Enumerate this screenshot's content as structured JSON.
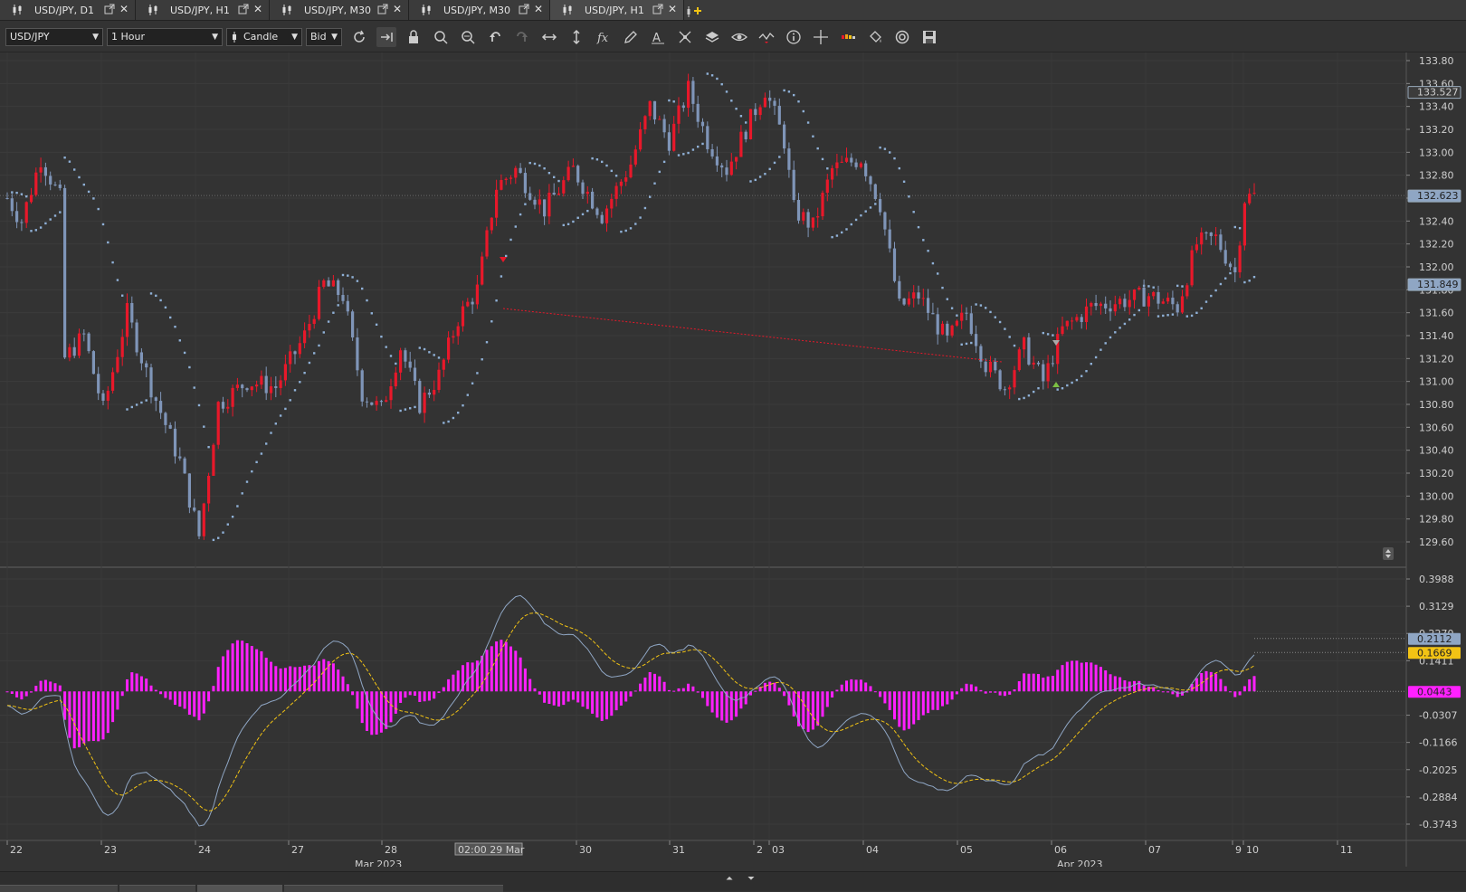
{
  "tabs": [
    {
      "label": "USD/JPY, D1",
      "active": false
    },
    {
      "label": "USD/JPY, H1",
      "active": false
    },
    {
      "label": "USD/JPY, M30",
      "active": false
    },
    {
      "label": "USD/JPY, M30",
      "active": false
    },
    {
      "label": "USD/JPY, H1",
      "active": true
    }
  ],
  "toolbar": {
    "instrument": "USD/JPY",
    "period": "1 Hour",
    "chart_type": "Candle",
    "price_side": "Bid",
    "icons": [
      "refresh-icon",
      "autoshift-icon",
      "lock-icon",
      "zoom-in-icon",
      "zoom-out-icon",
      "undo-icon",
      "redo-icon",
      "horizontal-scale-icon",
      "vertical-scale-icon",
      "indicators-fx-icon",
      "pencil-icon",
      "text-icon",
      "patterns-icon",
      "layers-icon",
      "eye-icon",
      "oscillator-icon",
      "info-icon",
      "crosshair-icon",
      "bars-icon",
      "paint-bucket-icon",
      "template-icon",
      "save-icon"
    ]
  },
  "price_axis": {
    "ticks": [
      "133.80",
      "133.60",
      "133.40",
      "133.20",
      "133.00",
      "132.80",
      "132.60",
      "132.40",
      "132.20",
      "132.00",
      "131.80",
      "131.60",
      "131.40",
      "131.20",
      "131.00",
      "130.80",
      "130.60",
      "130.40",
      "130.20",
      "130.00",
      "129.80",
      "129.60"
    ],
    "markers": [
      {
        "text": "133.527",
        "value": 133.527,
        "bg": "#3c3c3c",
        "fg": "#cfcfcf"
      },
      {
        "text": "132.623",
        "value": 132.623,
        "bg": "#8fa6c4",
        "fg": "#222222"
      },
      {
        "text": "131.849",
        "value": 131.849,
        "bg": "#8fa6c4",
        "fg": "#222222"
      }
    ]
  },
  "oscillator_axis": {
    "ticks": [
      "0.3988",
      "0.3129",
      "0.2270",
      "0.1411",
      "-0.0307",
      "-0.1166",
      "-0.2025",
      "-0.2884",
      "-0.3743"
    ],
    "markers": [
      {
        "text": "0.2112",
        "value": 0.2112,
        "bg": "#8fa6c4",
        "fg": "#222222"
      },
      {
        "text": "0.1669",
        "value": 0.1669,
        "bg": "#f2c314",
        "fg": "#222222"
      },
      {
        "text": "0.0443",
        "value": 0.0443,
        "bg": "#ff20ff",
        "fg": "#222222"
      }
    ]
  },
  "time_axis": {
    "day_labels": [
      "22",
      "23",
      "24",
      "27",
      "28",
      "30",
      "31",
      "2",
      "03",
      "04",
      "05",
      "06",
      "07",
      "9",
      "10",
      "11"
    ],
    "month_labels": [
      "Mar 2023",
      "Apr 2023"
    ],
    "cursor_label": "02:00 29 Mar"
  },
  "colors": {
    "bull": "#e8182a",
    "bear": "#7f95b8",
    "sar": "#8fb0d6",
    "macd_line": "#8fa6c4",
    "signal_line": "#f2c314",
    "histogram": "#ff20ff",
    "background": "#333333"
  },
  "chart_data": {
    "type": "candlestick",
    "instrument": "USD/JPY",
    "timeframe": "H1",
    "price_range": [
      129.6,
      133.8
    ],
    "price_path": [
      [
        0,
        132.6
      ],
      [
        3,
        132.4
      ],
      [
        7,
        132.95
      ],
      [
        11,
        132.6
      ],
      [
        12,
        131.2
      ],
      [
        16,
        131.4
      ],
      [
        20,
        130.75
      ],
      [
        25,
        131.6
      ],
      [
        30,
        130.95
      ],
      [
        36,
        130.3
      ],
      [
        40,
        129.65
      ],
      [
        44,
        130.8
      ],
      [
        50,
        131.0
      ],
      [
        56,
        130.95
      ],
      [
        62,
        131.4
      ],
      [
        66,
        131.85
      ],
      [
        70,
        131.75
      ],
      [
        74,
        130.9
      ],
      [
        78,
        130.75
      ],
      [
        82,
        131.3
      ],
      [
        86,
        130.8
      ],
      [
        90,
        131.05
      ],
      [
        94,
        131.55
      ],
      [
        98,
        131.8
      ],
      [
        102,
        132.7
      ],
      [
        106,
        132.85
      ],
      [
        112,
        132.5
      ],
      [
        118,
        132.85
      ],
      [
        124,
        132.45
      ],
      [
        130,
        132.9
      ],
      [
        134,
        133.4
      ],
      [
        138,
        133.1
      ],
      [
        142,
        133.55
      ],
      [
        146,
        133.1
      ],
      [
        150,
        132.85
      ],
      [
        154,
        133.2
      ],
      [
        158,
        133.55
      ],
      [
        162,
        133.1
      ],
      [
        164,
        132.5
      ],
      [
        168,
        132.35
      ],
      [
        172,
        132.85
      ],
      [
        178,
        132.95
      ],
      [
        182,
        132.55
      ],
      [
        186,
        131.65
      ],
      [
        190,
        131.75
      ],
      [
        196,
        131.35
      ],
      [
        200,
        131.6
      ],
      [
        204,
        131.15
      ],
      [
        208,
        130.95
      ],
      [
        212,
        131.3
      ],
      [
        216,
        131.0
      ],
      [
        220,
        131.45
      ],
      [
        226,
        131.65
      ],
      [
        232,
        131.7
      ],
      [
        238,
        131.75
      ],
      [
        244,
        131.65
      ],
      [
        248,
        132.2
      ],
      [
        252,
        132.25
      ],
      [
        256,
        131.95
      ],
      [
        258,
        132.6
      ],
      [
        260,
        132.62
      ]
    ],
    "parabolic_sar": {
      "last": 131.849
    },
    "macd": {
      "macd": 0.2112,
      "signal": 0.1669,
      "histogram": 0.0443
    },
    "oscillator_range": [
      -0.3743,
      0.3988
    ]
  }
}
